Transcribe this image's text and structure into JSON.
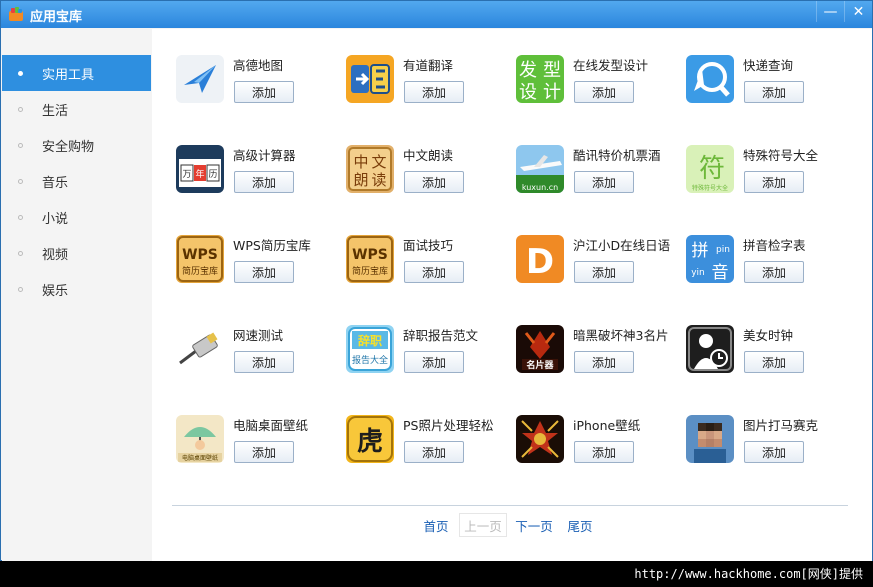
{
  "window": {
    "title": "应用宝库",
    "minimize": "—",
    "close": "✕"
  },
  "sidebar": {
    "items": [
      {
        "label": "实用工具",
        "active": true
      },
      {
        "label": "生活"
      },
      {
        "label": "安全购物"
      },
      {
        "label": "音乐"
      },
      {
        "label": "小说"
      },
      {
        "label": "视频"
      },
      {
        "label": "娱乐"
      }
    ]
  },
  "apps": [
    {
      "name": "高德地图",
      "icon": "map-plane-icon"
    },
    {
      "name": "有道翻译",
      "icon": "translate-icon"
    },
    {
      "name": "在线发型设计",
      "icon": "hair-design-icon",
      "icon_text": [
        "发",
        "型",
        "设",
        "计"
      ]
    },
    {
      "name": "快递查询",
      "icon": "express-search-icon"
    },
    {
      "name": "高级计算器",
      "icon": "calendar-calculator-icon",
      "icon_text": [
        "万",
        "年",
        "历"
      ]
    },
    {
      "name": "中文朗读",
      "icon": "chinese-reading-icon",
      "icon_text": [
        "中",
        "文",
        "朗",
        "读"
      ]
    },
    {
      "name": "酷讯特价机票酒",
      "icon": "airplane-icon",
      "icon_text": [
        "kuxun.cn"
      ]
    },
    {
      "name": "特殊符号大全",
      "icon": "symbol-icon",
      "icon_text": [
        "符",
        "特殊符号大全"
      ]
    },
    {
      "name": "WPS简历宝库",
      "icon": "wps-resume-icon",
      "icon_text": [
        "WPS",
        "简历宝库"
      ]
    },
    {
      "name": "面试技巧",
      "icon": "wps-interview-icon",
      "icon_text": [
        "WPS",
        "简历宝库"
      ]
    },
    {
      "name": "沪江小D在线日语",
      "icon": "letter-d-icon",
      "icon_text": [
        "D"
      ]
    },
    {
      "name": "拼音检字表",
      "icon": "pinyin-icon",
      "icon_text": [
        "拼",
        "pin",
        "yin",
        "音"
      ]
    },
    {
      "name": "网速测试",
      "icon": "network-cable-icon"
    },
    {
      "name": "辞职报告范文",
      "icon": "resignation-report-icon",
      "icon_text": [
        "辞职",
        "报告大全"
      ]
    },
    {
      "name": "暗黑破坏神3名片",
      "icon": "diablo-card-icon",
      "icon_text": [
        "名片器"
      ]
    },
    {
      "name": "美女时钟",
      "icon": "clock-person-icon"
    },
    {
      "name": "电脑桌面壁纸",
      "icon": "wallpaper-umbrella-icon",
      "icon_text": [
        "电脑桌面壁纸"
      ]
    },
    {
      "name": "PS照片处理轻松",
      "icon": "tiger-char-icon",
      "icon_text": [
        "虎"
      ]
    },
    {
      "name": "iPhone壁纸",
      "icon": "ornament-icon"
    },
    {
      "name": "图片打马赛克",
      "icon": "mosaic-face-icon"
    }
  ],
  "add_label": "添加",
  "pager": {
    "first": "首页",
    "prev": "上一页",
    "next": "下一页",
    "last": "尾页"
  },
  "footer": {
    "text": "http://www.hackhome.com[网侠]提供"
  },
  "colors": {
    "accent": "#2e8fe0",
    "titlebar": "#3a95e6"
  }
}
